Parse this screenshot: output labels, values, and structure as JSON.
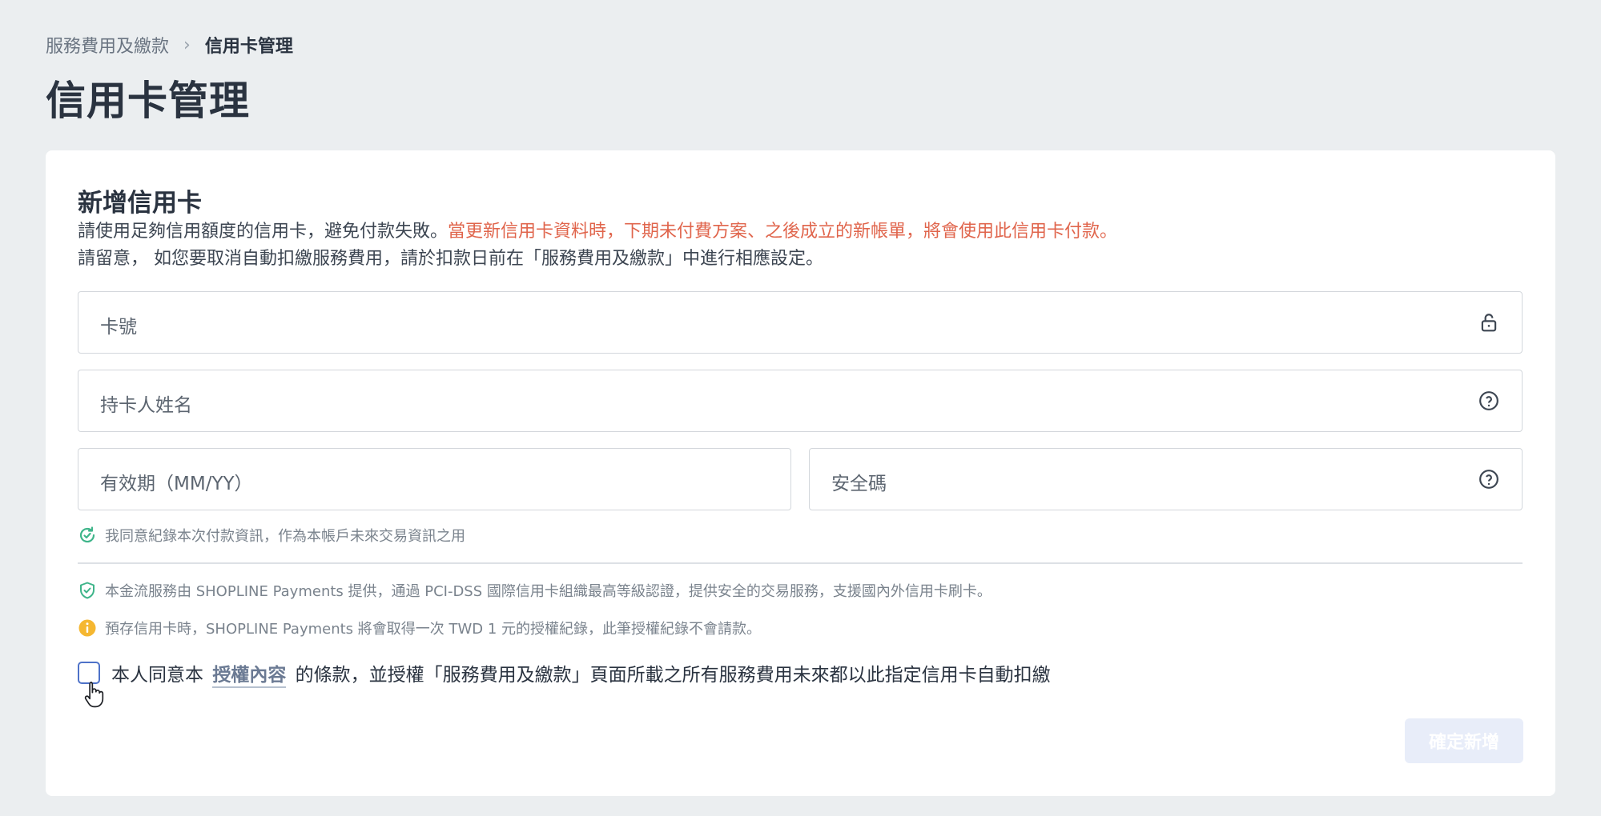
{
  "breadcrumb": {
    "parent": "服務費用及繳款",
    "current": "信用卡管理"
  },
  "page_title": "信用卡管理",
  "card": {
    "title": "新增信用卡",
    "desc_line1_normal": "請使用足夠信用額度的信用卡，避免付款失敗。",
    "desc_line1_warn": "當更新信用卡資料時，下期未付費方案、之後成立的新帳單，將會使用此信用卡付款。",
    "desc_line2": "請留意， 如您要取消自動扣繳服務費用，請於扣款日前在「服務費用及繳款」中進行相應設定。",
    "warn_color": "#e0654c"
  },
  "fields": {
    "card_number": "卡號",
    "cardholder_name": "持卡人姓名",
    "expiry": "有效期（MM/YY）",
    "security_code": "安全碼"
  },
  "notes": {
    "remember": "我同意紀錄本次付款資訊，作為本帳戶未來交易資訊之用",
    "secure": "本金流服務由 SHOPLINE Payments 提供，通過 PCI-DSS 國際信用卡組織最高等級認證，提供安全的交易服務，支援國內外信用卡刷卡。",
    "preauth": "預存信用卡時，SHOPLINE Payments 將會取得一次 TWD 1 元的授權紀錄，此筆授權紀錄不會請款。"
  },
  "agreement": {
    "prefix": "本人同意本",
    "link": "授權內容",
    "suffix": "的條款，並授權「服務費用及繳款」頁面所載之所有服務費用未來都以此指定信用卡自動扣繳",
    "checked": false
  },
  "submit_label": "確定新增",
  "icons": {
    "card_number": "lock-icon",
    "cardholder_name": "help-icon",
    "security_code": "help-icon",
    "remember": "refresh-check-icon",
    "secure": "shield-check-icon",
    "preauth": "info-icon"
  }
}
